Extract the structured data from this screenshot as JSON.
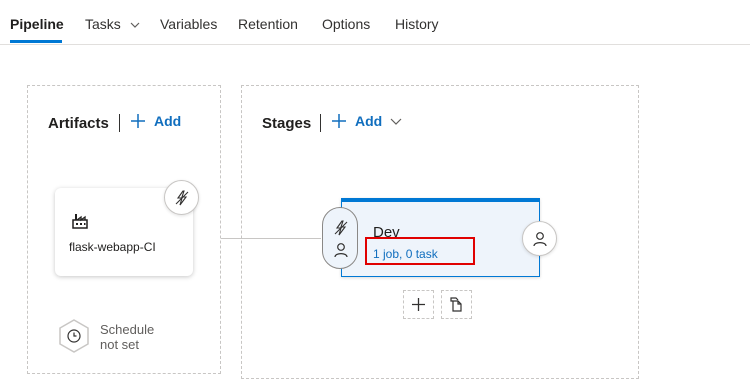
{
  "tabs": [
    {
      "label": "Pipeline",
      "active": true
    },
    {
      "label": "Tasks",
      "has_dropdown": true
    },
    {
      "label": "Variables"
    },
    {
      "label": "Retention"
    },
    {
      "label": "Options"
    },
    {
      "label": "History"
    }
  ],
  "artifacts": {
    "title": "Artifacts",
    "add_label": "Add",
    "items": [
      {
        "name": "flask-webapp-CI",
        "icon": "build-pipeline-icon",
        "trigger_icon": "lightning-icon"
      }
    ],
    "schedule": {
      "line1": "Schedule",
      "line2": "not set",
      "icon": "clock-icon"
    }
  },
  "stages": {
    "title": "Stages",
    "add_label": "Add",
    "items": [
      {
        "name": "Dev",
        "tasks": "1 job, 0 task"
      }
    ]
  },
  "colors": {
    "accent": "#0078d4",
    "link": "#106ebe",
    "highlight": "#e00000",
    "stage_bg": "#eef4fb"
  }
}
